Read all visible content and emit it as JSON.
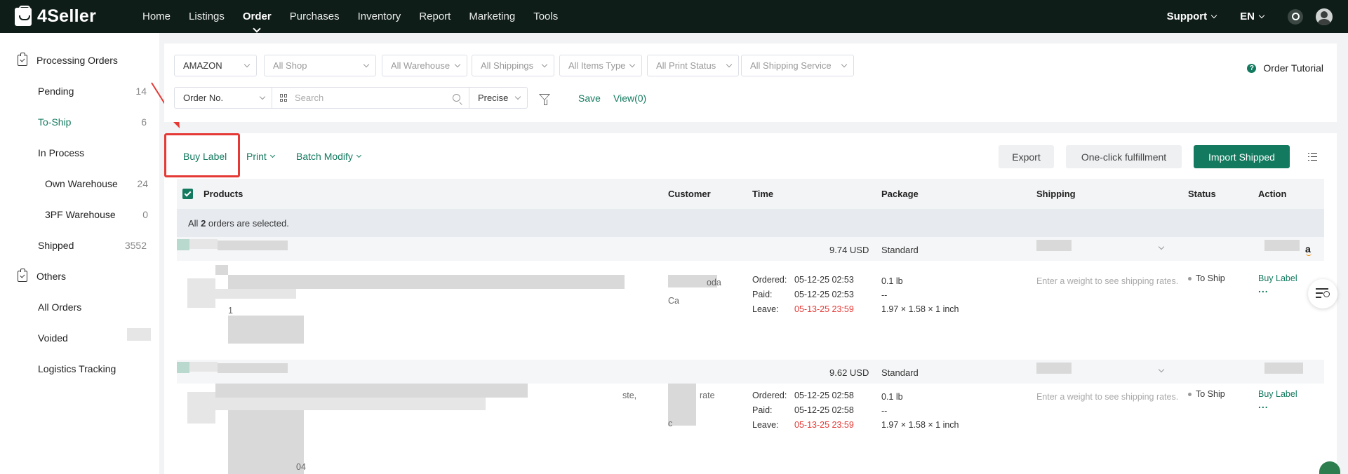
{
  "nav": {
    "brand": "4Seller",
    "items": [
      "Home",
      "Listings",
      "Order",
      "Purchases",
      "Inventory",
      "Report",
      "Marketing",
      "Tools"
    ],
    "active": "Order",
    "support": "Support",
    "lang": "EN"
  },
  "sidebar": {
    "processing_title": "Processing Orders",
    "pending": {
      "label": "Pending",
      "count": "14"
    },
    "toship": {
      "label": "To-Ship",
      "count": "6"
    },
    "inprocess": {
      "label": "In Process"
    },
    "own": {
      "label": "Own Warehouse",
      "count": "24"
    },
    "tpf": {
      "label": "3PF Warehouse",
      "count": "0"
    },
    "shipped": {
      "label": "Shipped",
      "count": "3552"
    },
    "others_title": "Others",
    "all_orders": "All Orders",
    "voided": "Voided",
    "logistics": "Logistics Tracking"
  },
  "filters": {
    "platform": "AMAZON",
    "shop": "All Shop",
    "warehouse": "All Warehouse",
    "shippings": "All Shippings",
    "items_type": "All Items Type",
    "print_status": "All Print Status",
    "shipping_service": "All Shipping Service",
    "order_no": "Order No.",
    "search_placeholder": "Search",
    "precise": "Precise",
    "save": "Save",
    "view": "View(0)",
    "tutorial": "Order Tutorial"
  },
  "toolbar": {
    "buy_label": "Buy Label",
    "print": "Print",
    "batch_modify": "Batch Modify",
    "export": "Export",
    "one_click": "One-click fulfillment",
    "import_shipped": "Import Shipped"
  },
  "table": {
    "headers": {
      "products": "Products",
      "customer": "Customer",
      "time": "Time",
      "package": "Package",
      "shipping": "Shipping",
      "status": "Status",
      "action": "Action"
    },
    "selected_prefix": "All ",
    "selected_count": "2",
    "selected_suffix": " orders are selected."
  },
  "labels": {
    "ordered": "Ordered:",
    "paid": "Paid:",
    "leave": "Leave:",
    "shipping_placeholder": "Enter a weight to see shipping rates."
  },
  "orders": [
    {
      "amount": "9.74 USD",
      "package_type": "Standard",
      "customer_partial": "oda",
      "customer_line2": "Ca",
      "sku_partial": "1",
      "ordered": "05-12-25 02:53",
      "paid": "05-12-25 02:53",
      "leave": "05-13-25 23:59",
      "weight": "0.1 lb",
      "dash": "--",
      "dims": "1.97 × 1.58 × 1 inch",
      "status": "To Ship",
      "action": "Buy Label",
      "more": "..."
    },
    {
      "amount": "9.62 USD",
      "package_type": "Standard",
      "customer_partial": "rate",
      "title_partial": "ste,",
      "customer_line3": "c",
      "sku_partial": "04",
      "ordered": "05-12-25 02:58",
      "paid": "05-12-25 02:58",
      "leave": "05-13-25 23:59",
      "weight": "0.1 lb",
      "dash": "--",
      "dims": "1.97 × 1.58 × 1 inch",
      "status": "To Ship",
      "action": "Buy Label",
      "more": "..."
    }
  ],
  "colors": {
    "brand_green": "#137a5f",
    "nav_bg": "#0f1d18",
    "highlight_red": "#e53935"
  }
}
